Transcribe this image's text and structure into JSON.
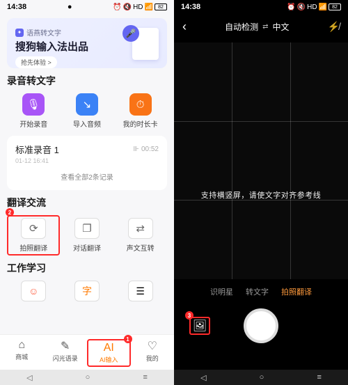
{
  "status": {
    "time": "14:38",
    "battery": "82"
  },
  "left": {
    "banner": {
      "tag": "语燕转文字",
      "title": "搜狗输入法出品",
      "btn": "抢先体验 >"
    },
    "sec1": {
      "title": "录音转文字",
      "a": "开始录音",
      "b": "导入音频",
      "c": "我的时长卡"
    },
    "rec": {
      "name": "标准录音 1",
      "dur": "00:52",
      "time": "01-12 16:41",
      "all": "查看全部2条记录"
    },
    "sec2": {
      "title": "翻译交流",
      "a": "拍照翻译",
      "b": "对话翻译",
      "c": "声文互转"
    },
    "sec3": {
      "title": "工作学习"
    },
    "nav": {
      "a": "商城",
      "b": "闪光语录",
      "c": "AI输入",
      "d": "我的"
    }
  },
  "right": {
    "lang": {
      "from": "自动检测",
      "to": "中文"
    },
    "hint": "支持横竖屏，请使文字对齐参考线",
    "modes": {
      "a": "识明星",
      "b": "转文字",
      "c": "拍照翻译"
    }
  }
}
